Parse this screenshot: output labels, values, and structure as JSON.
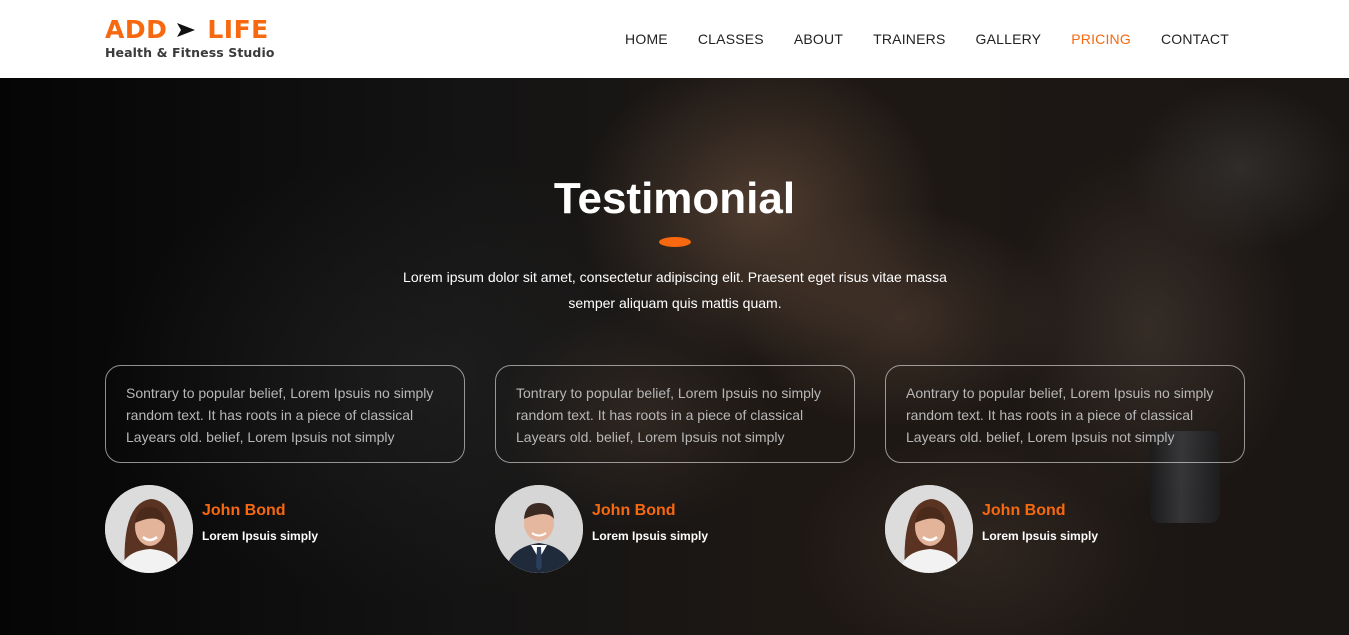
{
  "logo": {
    "word_left": "ADD",
    "word_right": "LIFE",
    "tagline": "Health & Fitness Studio"
  },
  "nav": [
    {
      "label": "HOME",
      "active": false
    },
    {
      "label": "CLASSES",
      "active": false
    },
    {
      "label": "ABOUT",
      "active": false
    },
    {
      "label": "TRAINERS",
      "active": false
    },
    {
      "label": "GALLERY",
      "active": false
    },
    {
      "label": "PRICING",
      "active": true
    },
    {
      "label": "CONTACT",
      "active": false
    }
  ],
  "section": {
    "title": "Testimonial",
    "intro_line1": "Lorem ipsum dolor sit amet, consectetur adipiscing elit. Praesent eget risus vitae massa",
    "intro_line2": "semper aliquam quis mattis quam."
  },
  "testimonials": [
    {
      "line1": "Sontrary to popular belief, Lorem Ipsuis no simply",
      "line2": "random text. It has roots in a piece of classical",
      "line3": "Layears old. belief, Lorem Ipsuis not simply",
      "name": "John Bond",
      "role": "Lorem Ipsuis simply",
      "avatar": "woman-avatar"
    },
    {
      "line1": "Tontrary to popular belief, Lorem Ipsuis no simply",
      "line2": "random text. It has roots in a piece of classical",
      "line3": "Layears old. belief, Lorem Ipsuis not simply",
      "name": "John Bond",
      "role": "Lorem Ipsuis simply",
      "avatar": "man-avatar"
    },
    {
      "line1": "Aontrary to popular belief, Lorem Ipsuis no simply",
      "line2": "random text. It has roots in a piece of classical",
      "line3": "Layears old. belief, Lorem Ipsuis not simply",
      "name": "John Bond",
      "role": "Lorem Ipsuis simply",
      "avatar": "woman-avatar"
    }
  ],
  "colors": {
    "accent": "#f7680f",
    "header_bg": "#ffffff",
    "nav_text": "#222222"
  }
}
